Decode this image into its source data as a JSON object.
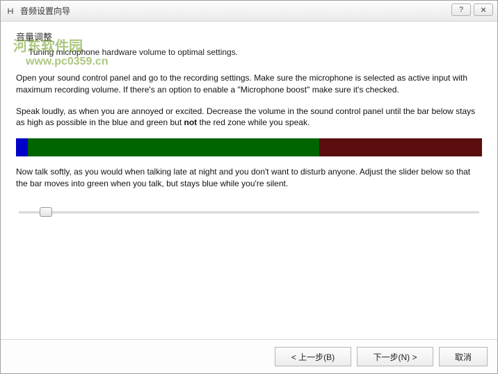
{
  "window": {
    "title": "音频设置向导"
  },
  "watermark": {
    "text_cn": "河东软件园",
    "url": "www.pc0359.cn"
  },
  "header": {
    "heading": "音量调整",
    "sub": "Tuning microphone hardware volume to optimal settings."
  },
  "body": {
    "para1": "Open your sound control panel and go to the recording settings. Make sure the microphone is selected as active input with maximum recording volume. If there's an option to enable a \"Microphone boost\" make sure it's checked.",
    "para2_a": "Speak loudly, as when you are annoyed or excited. Decrease the volume in the sound control panel until the bar below stays as high as possible in the blue and green but ",
    "para2_bold": "not",
    "para2_b": " the red zone while you speak.",
    "para3": "Now talk softly, as you would when talking late at night and you don't want to disturb anyone. Adjust the slider below so that the bar moves into green when you talk, but stays blue while you're silent."
  },
  "volume_bar": {
    "blue_pct": 2.5,
    "green_pct": 62.5,
    "red_pct": 35
  },
  "slider": {
    "position_pct": 4.5
  },
  "footer": {
    "back": "< 上一步(B)",
    "next": "下一步(N) >",
    "cancel": "取消"
  },
  "titlebar_controls": {
    "help": "?",
    "close": "✕"
  }
}
